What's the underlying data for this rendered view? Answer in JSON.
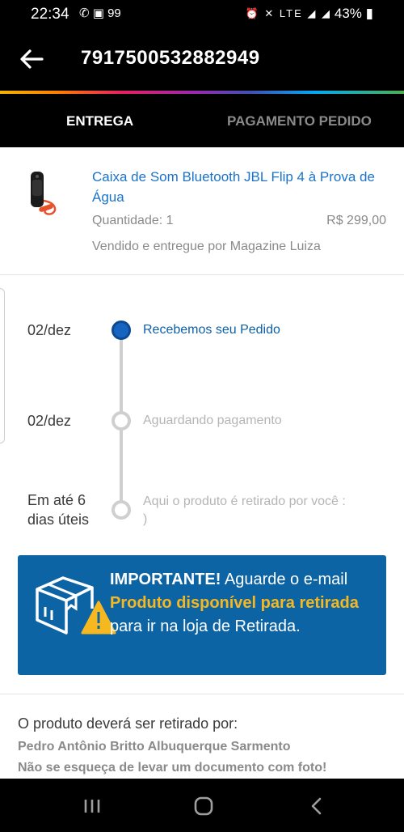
{
  "status_bar": {
    "time": "22:34",
    "left_icons": "✆ ▣ 99",
    "right_icons": "⏰ ✕ LTE ◢ ◢",
    "battery": "43%"
  },
  "app_bar": {
    "back_icon": "arrow-left",
    "title": "7917500532882949"
  },
  "tabs": [
    {
      "label": "ENTREGA",
      "active": true
    },
    {
      "label": "PAGAMENTO PEDIDO",
      "active": false
    }
  ],
  "product": {
    "name": "Caixa de Som Bluetooth JBL Flip 4 à Prova de Água",
    "quantity": "Quantidade: 1",
    "price": "R$ 299,00",
    "seller": "Vendido e entregue por Magazine Luiza"
  },
  "timeline": [
    {
      "date": "02/dez",
      "label": "Recebemos seu Pedido",
      "active": true
    },
    {
      "date": "02/dez",
      "label": "Aguardando pagamento",
      "active": false
    },
    {
      "date": "Em até 6 dias úteis",
      "label": "Aqui o produto é retirado por você : )",
      "active": false
    }
  ],
  "notice": {
    "icon": "box-warning-icon",
    "strong": "IMPORTANTE!",
    "text1": " Aguarde o e-mail ",
    "highlight": "Produto disponível para retirada",
    "text2": " para ir na loja de Retirada."
  },
  "pickup": {
    "title": "O produto deverá ser retirado por:",
    "name": "Pedro Antônio Britto Albuquerque Sarmento",
    "note": "Não se esqueça de levar um documento com foto!"
  },
  "nav_bar": {
    "recents_icon": "recents-icon",
    "home_icon": "home-icon",
    "back_icon": "back-icon"
  },
  "colors": {
    "accent_blue": "#1a73c9",
    "notice_bg": "#0c64a5",
    "highlight_yellow": "#f6b820"
  }
}
